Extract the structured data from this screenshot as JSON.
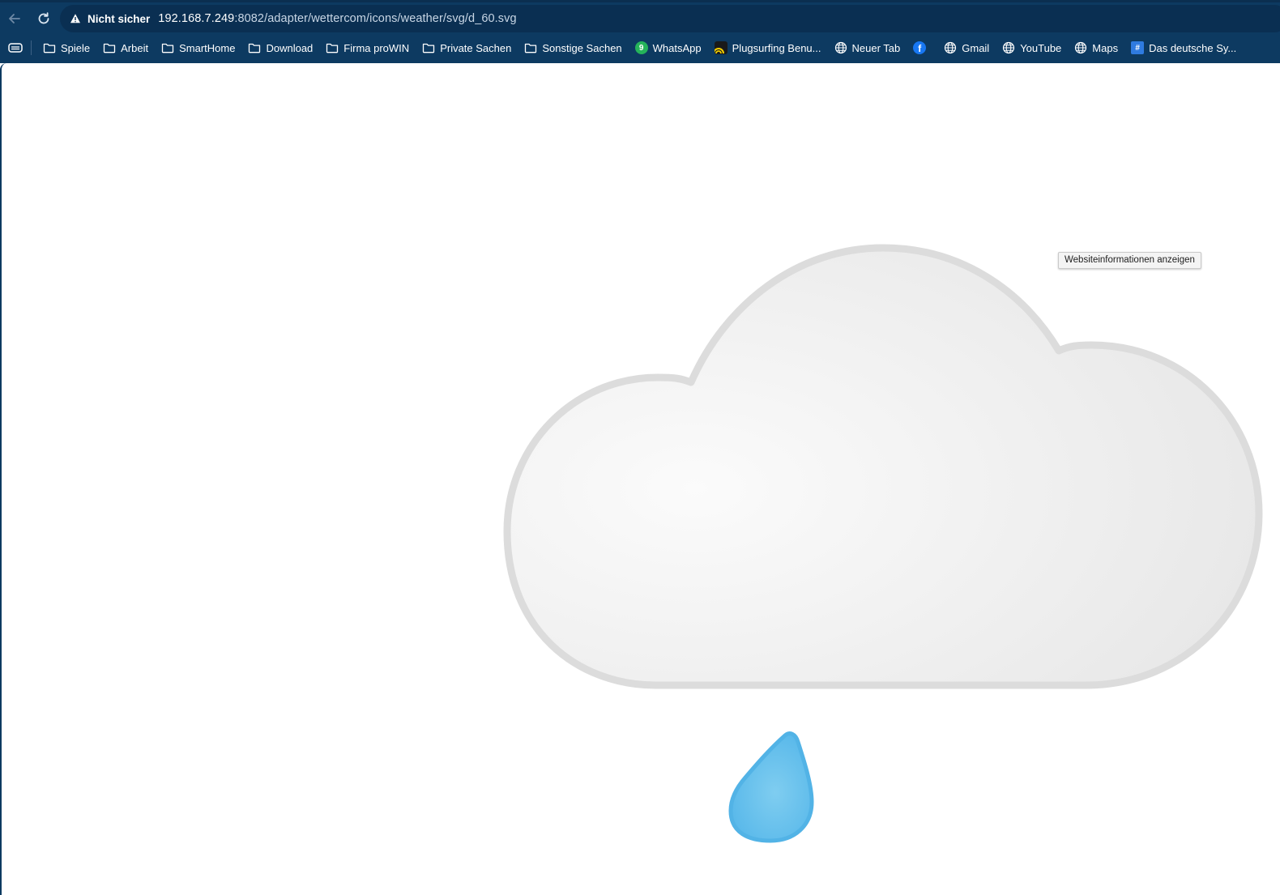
{
  "browser": {
    "security_label": "Nicht sicher",
    "url_host": "192.168.7.249",
    "url_rest": ":8082/adapter/wettercom/icons/weather/svg/d_60.svg",
    "tooltip": "Websiteinformationen anzeigen"
  },
  "bookmarks": [
    {
      "label": "Spiele",
      "icon": "folder-icon"
    },
    {
      "label": "Arbeit",
      "icon": "folder-icon"
    },
    {
      "label": "SmartHome",
      "icon": "folder-icon"
    },
    {
      "label": "Download",
      "icon": "folder-icon"
    },
    {
      "label": "Firma proWIN",
      "icon": "folder-icon"
    },
    {
      "label": "Private Sachen",
      "icon": "folder-icon"
    },
    {
      "label": "Sonstige Sachen",
      "icon": "folder-icon"
    },
    {
      "label": "WhatsApp",
      "icon": "whatsapp-icon",
      "badge": "9"
    },
    {
      "label": "Plugsurfing Benu...",
      "icon": "plugsurfing-icon"
    },
    {
      "label": "Neuer Tab",
      "icon": "globe-icon"
    },
    {
      "label": "",
      "icon": "facebook-icon"
    },
    {
      "label": "Gmail",
      "icon": "globe-icon"
    },
    {
      "label": "YouTube",
      "icon": "globe-icon"
    },
    {
      "label": "Maps",
      "icon": "globe-icon"
    },
    {
      "label": "Das deutsche Sy...",
      "icon": "das-deutsche-icon"
    }
  ],
  "colors": {
    "chrome_bg": "#0d3a61",
    "omnibox_bg": "#0a2f52",
    "cloud_fill": "#f3f3f3",
    "cloud_stroke": "#dcdcdc",
    "raindrop": "#5ab9ea"
  }
}
